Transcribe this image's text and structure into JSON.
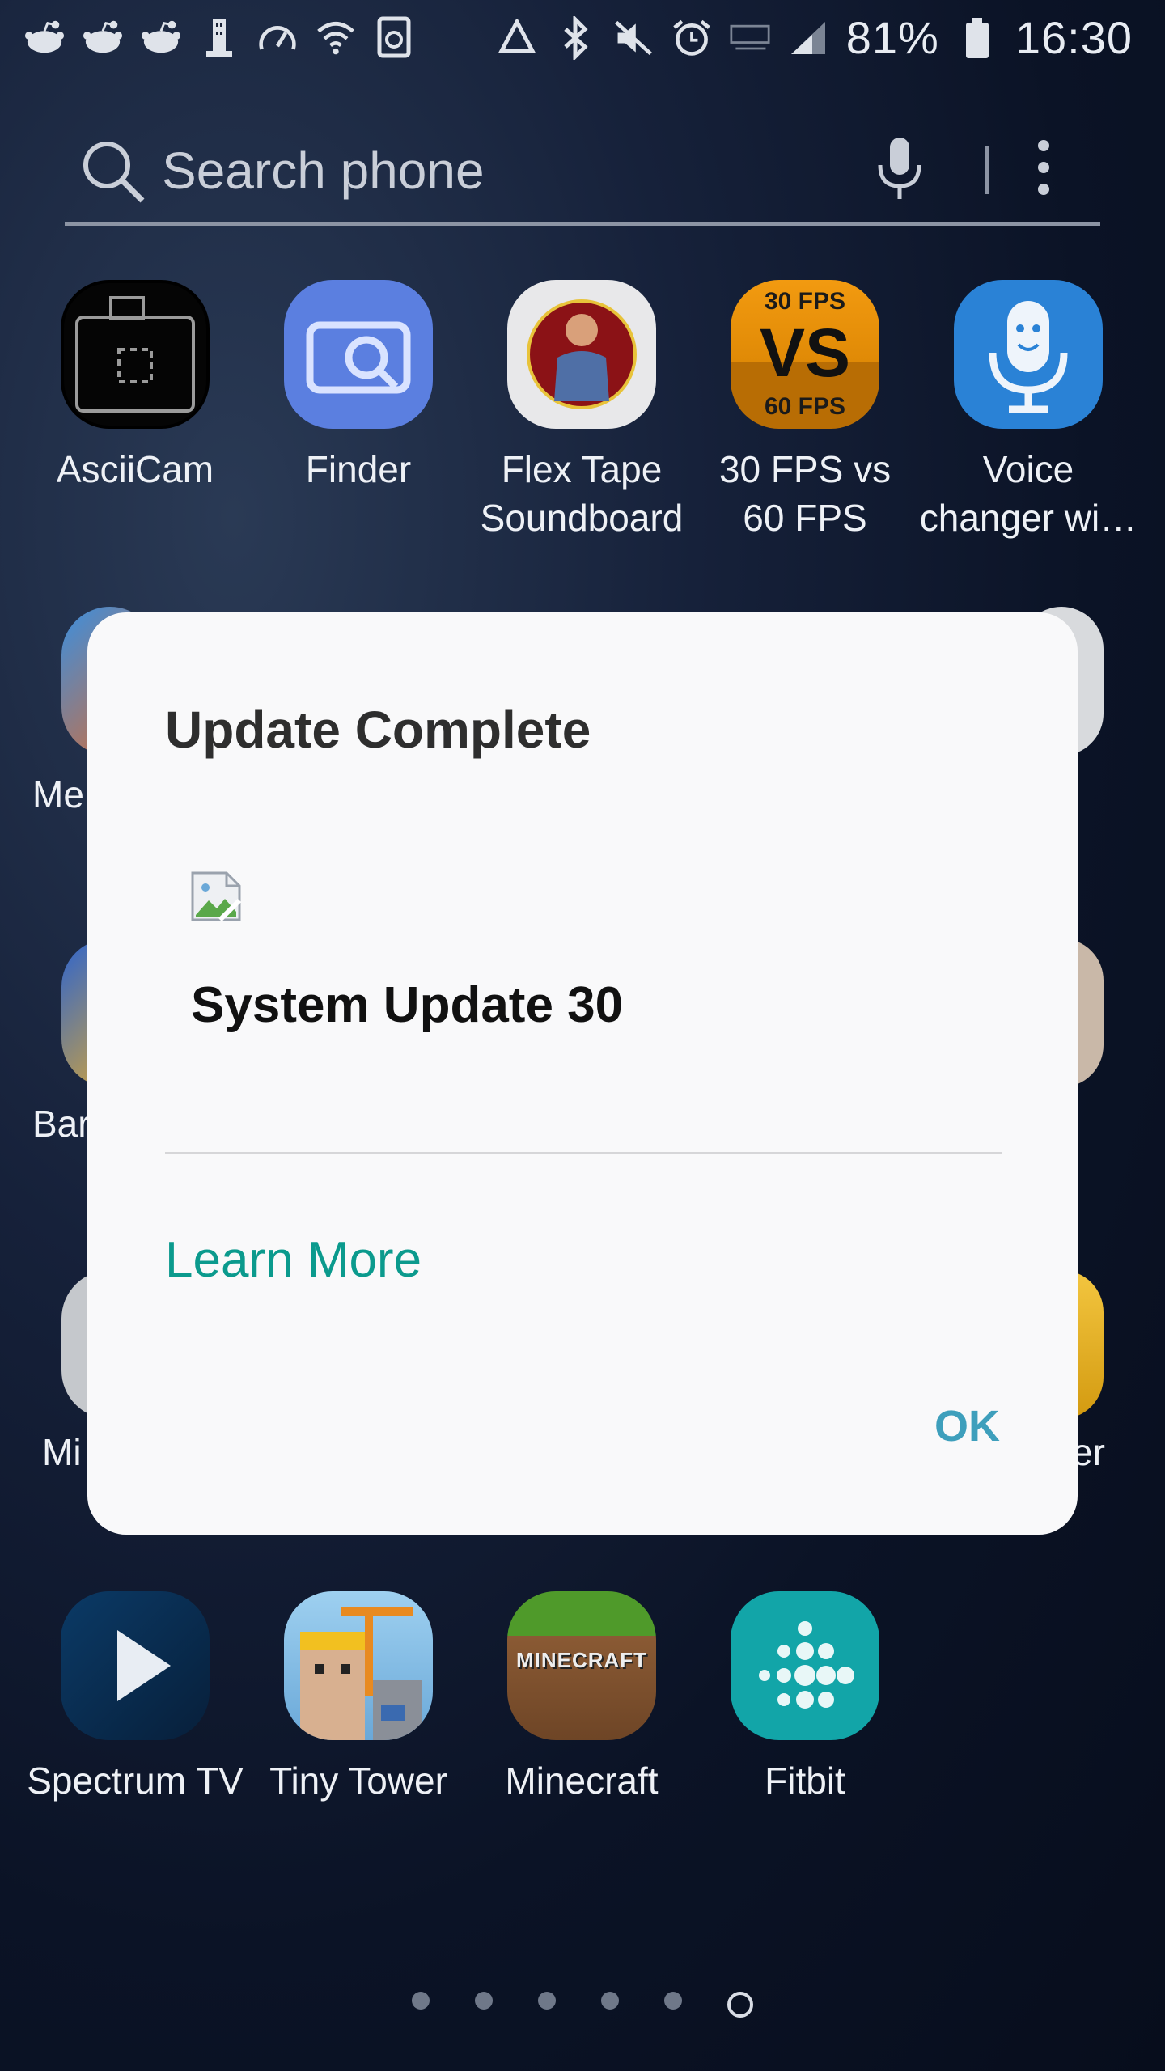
{
  "statusbar": {
    "battery": "81%",
    "time": "16:30"
  },
  "search": {
    "placeholder": "Search phone"
  },
  "apps_row1": [
    {
      "label": "AsciiCam"
    },
    {
      "label": "Finder"
    },
    {
      "label": "Flex Tape Soundboard"
    },
    {
      "label": "30 FPS vs 60 FPS",
      "icon_text_top": "30 FPS",
      "icon_text_mid": "VS",
      "icon_text_bot": "60 FPS"
    },
    {
      "label": "Voice changer wi…"
    }
  ],
  "apps_partial": [
    {
      "label": "Me"
    },
    {
      "label": "Bar"
    },
    {
      "label": "Mi"
    },
    {
      "label": "er"
    }
  ],
  "apps_row5": [
    {
      "label": "Spectrum TV"
    },
    {
      "label": "Tiny Tower"
    },
    {
      "label": "Minecraft",
      "icon_text": "MINECRAFT"
    },
    {
      "label": "Fitbit"
    }
  ],
  "dialog": {
    "title": "Update Complete",
    "subtitle": "System Update 30",
    "link": "Learn More",
    "ok": "OK"
  },
  "page_indicator": {
    "count": 6,
    "active_index": 5
  },
  "colors": {
    "link": "#0b9a8d",
    "ok": "#3e9fbc",
    "dialog_bg": "#f9f9fa"
  }
}
